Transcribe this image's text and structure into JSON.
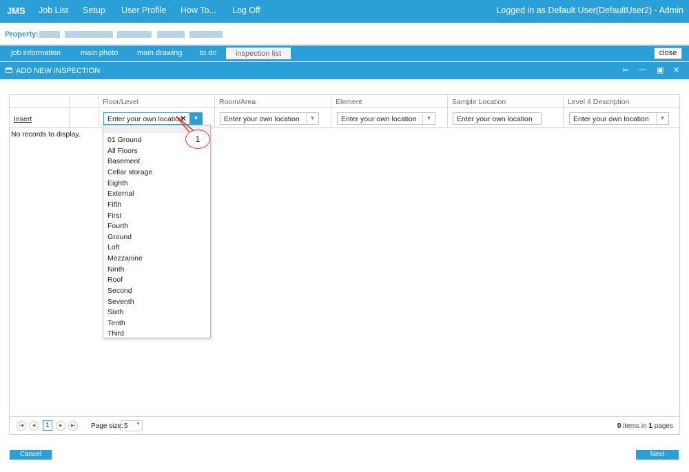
{
  "nav": {
    "brand": "JMS",
    "items": [
      "Job List",
      "Setup",
      "User Profile",
      "How To...",
      "Log Off"
    ],
    "logged_in": "Logged in as Default User(DefaultUser2) - Admin"
  },
  "property": {
    "label": "Property:"
  },
  "tabs": {
    "items": [
      "job information",
      "main photo",
      "main drawing",
      "to do",
      "inspection list"
    ],
    "active": "inspection list",
    "close": "close"
  },
  "window": {
    "title": "ADD NEW INSPECTION"
  },
  "grid": {
    "columns": [
      "Floor/Level",
      "Room/Area",
      "Element",
      "Sample Location",
      "Level 4 Description"
    ],
    "insert_label": "Insert",
    "placeholders": {
      "floor": "Enter your own location",
      "room": "Enter your own location",
      "element": "Enter your own location",
      "sample": "Enter your own location",
      "level4": "Enter your own location"
    },
    "no_records": "No records to display."
  },
  "dropdown": {
    "options": [
      "01 Ground",
      "All Floors",
      "Basement",
      "Cellar storage",
      "Eighth",
      "External",
      "Fifth",
      "First",
      "Fourth",
      "Ground",
      "Loft",
      "Mezzanine",
      "Ninth",
      "Roof",
      "Second",
      "Seventh",
      "Sixth",
      "Tenth",
      "Third"
    ]
  },
  "callout": {
    "number": "1"
  },
  "pager": {
    "current_page": "1",
    "page_size_label": "Page size:",
    "page_size": "5",
    "items_count": "0",
    "items_in": "items in",
    "pages_count": "1",
    "pages_label": "pages"
  },
  "buttons": {
    "cancel": "Cancel",
    "next": "Next"
  },
  "colors": {
    "accent": "#2a9fd8",
    "callout": "#e03030"
  }
}
